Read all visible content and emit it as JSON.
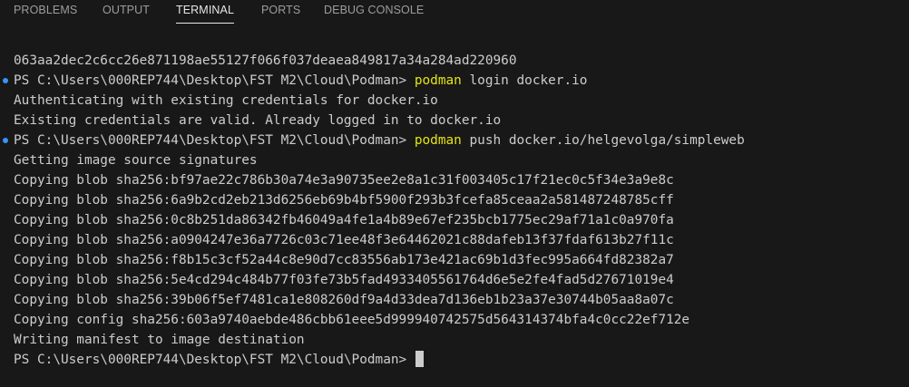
{
  "tabs": [
    "PROBLEMS",
    "OUTPUT",
    "TERMINAL",
    "PORTS",
    "DEBUG CONSOLE"
  ],
  "active_tab": "TERMINAL",
  "colors": {
    "background": "#181818",
    "text": "#cccccc",
    "command_highlight": "#e5e510",
    "prompt_marker": "#3794ff"
  },
  "terminal": {
    "prompt": "PS C:\\Users\\000REP744\\Desktop\\FST M2\\Cloud\\Podman> ",
    "command_keyword": "podman",
    "lines": [
      "063aa2dec2c6cc26e871198ae55127f066f037deaea849817a34a284ad220960",
      " login docker.io",
      "Authenticating with existing credentials for docker.io",
      "Existing credentials are valid. Already logged in to docker.io",
      " push docker.io/helgevolga/simpleweb",
      "Getting image source signatures",
      "Copying blob sha256:bf97ae22c786b30a74e3a90735ee2e8a1c31f003405c17f21ec0c5f34e3a9e8c",
      "Copying blob sha256:6a9b2cd2eb213d6256eb69b4bf5900f293b3fcefa85ceaa2a581487248785cff",
      "Copying blob sha256:0c8b251da86342fb46049a4fe1a4b89e67ef235bcb1775ec29af71a1c0a970fa",
      "Copying blob sha256:a0904247e36a7726c03c71ee48f3e64462021c88dafeb13f37fdaf613b27f11c",
      "Copying blob sha256:f8b15c3cf52a44c8e90d7cc83556ab173e421ac69b1d3fec995a664fd82382a7",
      "Copying blob sha256:5e4cd294c484b77f03fe73b5fad4933405561764d6e5e2fe4fad5d27671019e4",
      "Copying blob sha256:39b06f5ef7481ca1e808260df9a4d33dea7d136eb1b23a37e30744b05aa8a07c",
      "Copying config sha256:603a9740aebde486cbb61eee5d999940742575d564314374bfa4c0cc22ef712e",
      "Writing manifest to image destination"
    ]
  }
}
